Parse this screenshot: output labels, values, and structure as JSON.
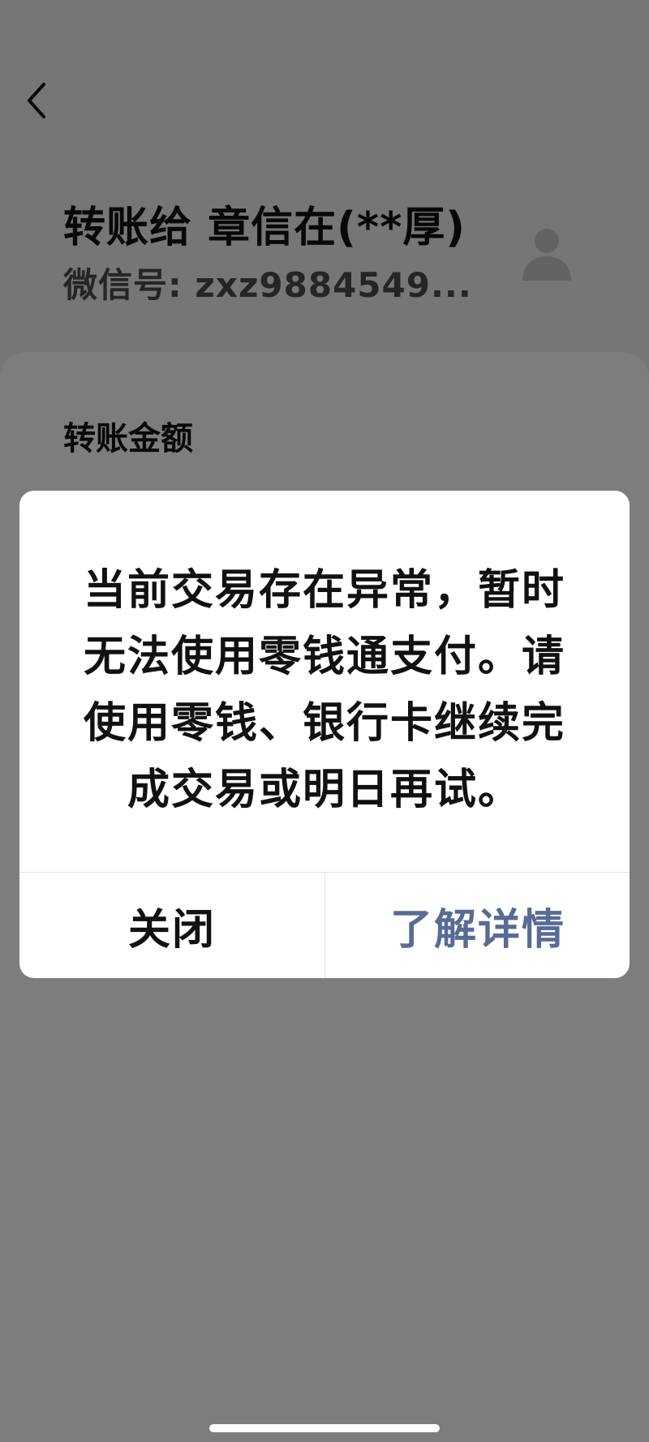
{
  "header": {
    "title": "转账给 章信在(**厚)",
    "subtitle": "微信号: zxz9884549..."
  },
  "transfer": {
    "amount_label": "转账金额"
  },
  "dialog": {
    "message": "当前交易存在异常，暂时无法使用零钱通支付。请使用零钱、银行卡继续完成交易或明日再试。",
    "close_label": "关闭",
    "details_label": "了解详情"
  },
  "icons": {
    "back": "chevron-left-icon",
    "avatar": "default-avatar-icon"
  },
  "colors": {
    "link": "#576b95",
    "text": "#111111",
    "background": "#ededed",
    "card": "#fafafa"
  }
}
